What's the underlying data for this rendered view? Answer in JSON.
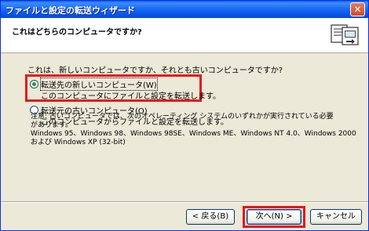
{
  "window": {
    "title": "ファイルと設定の転送ウィザード",
    "close_glyph": "✕"
  },
  "header": {
    "heading": "これはどちらのコンピュータですか?",
    "icon": "transfer-wizard-icon"
  },
  "main": {
    "question": "これは、新しいコンピュータですか、それとも古いコンピュータですか?",
    "options": [
      {
        "label": "転送先の新しいコンピュータ(W)",
        "description": "このコンピュータにファイルと設定を転送します。",
        "selected": true
      },
      {
        "label": "転送元の古いコンピュータ(O)",
        "description": "このコンピュータからファイルと設定を転送します。",
        "selected": false
      }
    ],
    "note_lines": [
      "注意: 古いコンピュータでは、次のオペレーティング システムのいずれかが実行されている必要",
      "があります。",
      "Windows 95、Windows 98、Windows 98SE、Windows ME、Windows NT 4.0、Windows 2000",
      "および Windows XP (32-bit)"
    ]
  },
  "buttons": {
    "back": "< 戻る(B)",
    "next": "次へ(N) >",
    "cancel": "キャンセル"
  },
  "colors": {
    "highlight": "#e8141c",
    "titlebar": "#0a5cf7",
    "background": "#ece9d8"
  }
}
